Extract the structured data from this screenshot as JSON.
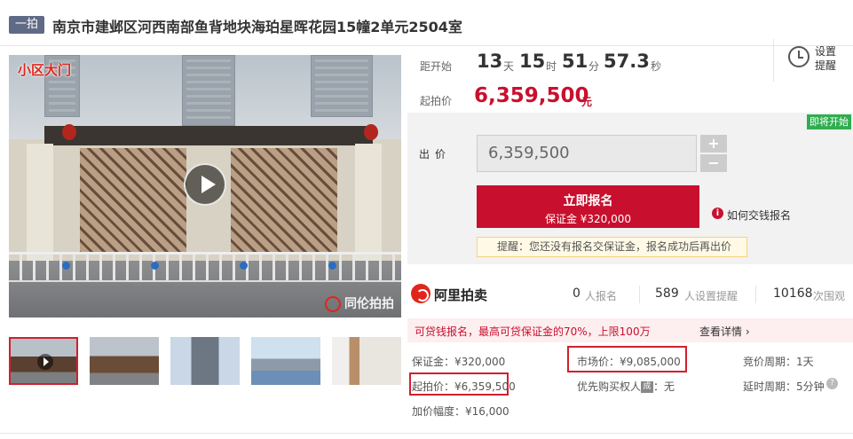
{
  "header": {
    "tag": "一拍",
    "title": "南京市建邺区河西南部鱼背地块海珀星晖花园15幢2单元2504室"
  },
  "media": {
    "overlay_label": "小区大门",
    "watermark": "同伦拍拍",
    "thumbnails": [
      "video-gate-1",
      "photo-gate-2",
      "photo-tower",
      "photo-street",
      "photo-interior"
    ]
  },
  "countdown": {
    "label": "距开始",
    "days": "13",
    "days_unit": "天",
    "hours": "15",
    "hours_unit": "时",
    "minutes": "51",
    "minutes_unit": "分",
    "seconds": "57.3",
    "seconds_unit": "秒"
  },
  "start_price": {
    "label": "起拍价",
    "value": "6,359,500",
    "unit": "元"
  },
  "reminder": {
    "label": "设置提醒"
  },
  "bid": {
    "badge": "即将开始",
    "label": "出价",
    "value": "6,359,500",
    "plus": "+",
    "minus": "−",
    "signup_label": "立即报名",
    "deposit_label": "保证金 ¥320,000",
    "how_link": "如何交钱报名",
    "tip": "提醒：您还没有报名交保证金，报名成功后再出价"
  },
  "stats": {
    "brand": "阿里拍卖",
    "signups": "0",
    "signups_label": "人报名",
    "reminders": "589",
    "reminders_label": "人设置提醒",
    "views": "10168",
    "views_label": "次围观"
  },
  "promo": {
    "text": "可贷钱报名，最高可贷保证金的70%，上限100万",
    "link": "查看详情"
  },
  "details": {
    "deposit": "保证金：¥320,000",
    "market_price": "市场价：¥9,085,000",
    "bid_cycle": "竞价周期：1天",
    "start_price": "起拍价：¥6,359,500",
    "priority_prefix": "优先购买权人",
    "priority_badge": "成",
    "priority_value": "：无",
    "delay_cycle": "延时周期：5分钟",
    "increment": "加价幅度：¥16,000"
  },
  "colors": {
    "brand_red": "#c8102e",
    "badge_green": "#2eae4f",
    "tag_gray": "#5f6a86"
  }
}
